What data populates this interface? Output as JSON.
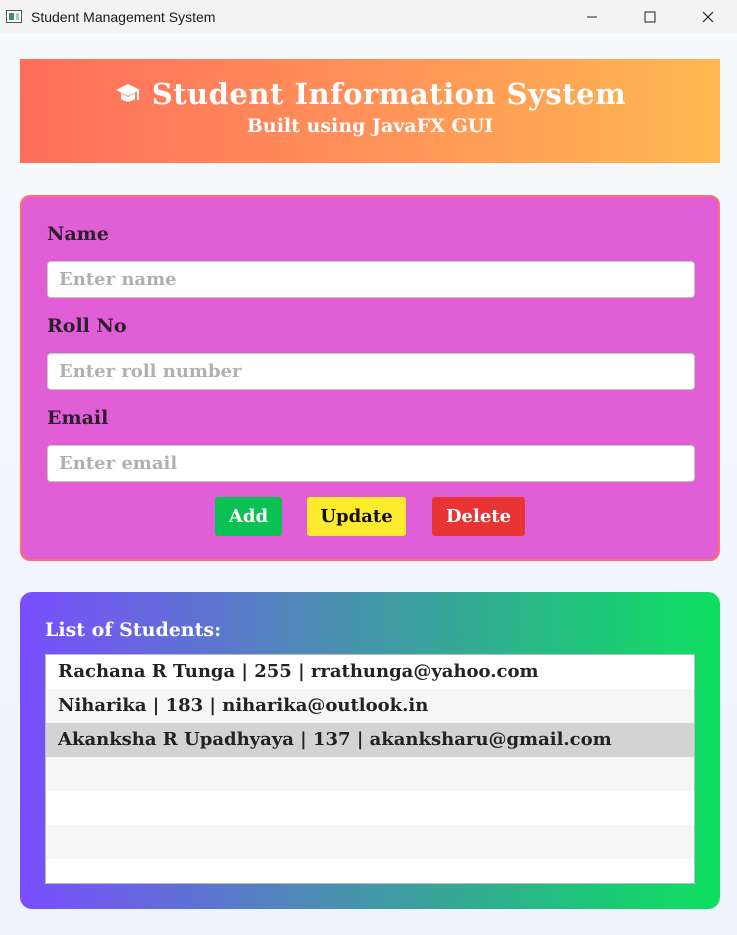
{
  "window": {
    "title": "Student Management System",
    "controls": [
      "minimize",
      "maximize",
      "close"
    ]
  },
  "header": {
    "icon": "graduation-cap-icon",
    "title": "Student Information System",
    "subtitle": "Built using JavaFX GUI"
  },
  "form": {
    "name_label": "Name",
    "name_placeholder": "Enter name",
    "name_value": "",
    "roll_label": "Roll No",
    "roll_placeholder": "Enter roll number",
    "roll_value": "",
    "email_label": "Email",
    "email_placeholder": "Enter email",
    "email_value": "",
    "add_label": "Add",
    "update_label": "Update",
    "delete_label": "Delete"
  },
  "list": {
    "title": "List of Students:",
    "items": [
      "Rachana R Tunga | 255 | rrathunga@yahoo.com",
      "Niharika | 183 | niharika@outlook.in",
      "Akanksha R Upadhyaya | 137 | akanksharu@gmail.com"
    ],
    "selected_index": 2
  },
  "colors": {
    "header_gradient": [
      "#ff6e5c",
      "#ffb850"
    ],
    "form_bg": "#e05ed6",
    "add": "#0ac253",
    "update": "#ffeb2e",
    "delete": "#e83434",
    "list_gradient": [
      "#7a4dff",
      "#0ee060"
    ]
  }
}
